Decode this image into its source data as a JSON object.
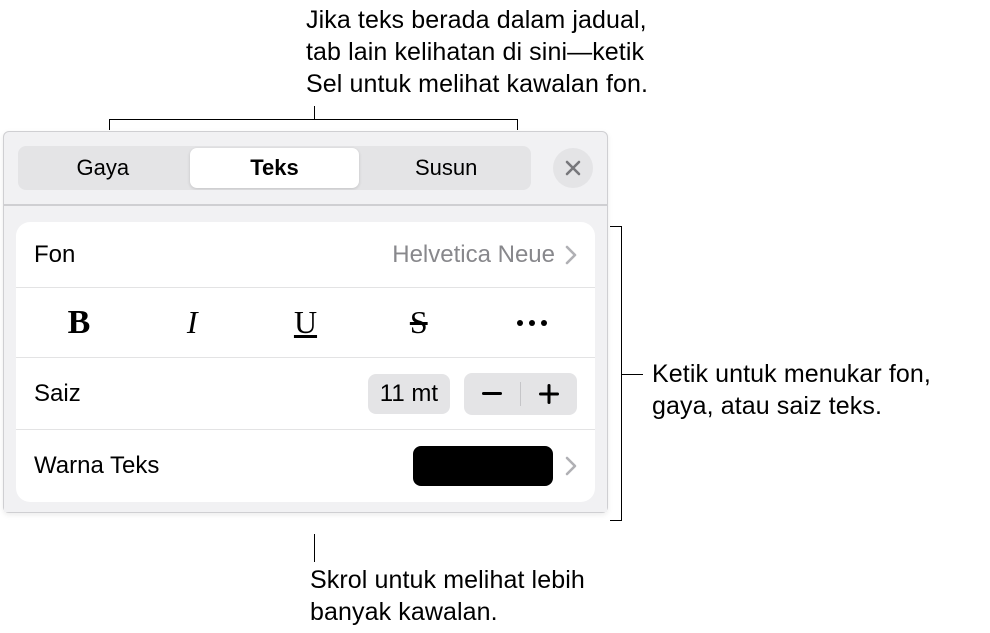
{
  "callouts": {
    "top": "Jika teks berada dalam jadual, tab lain kelihatan di sini—ketik Sel untuk melihat kawalan fon.",
    "right": "Ketik untuk menukar fon, gaya, atau saiz teks.",
    "bottom": "Skrol untuk melihat lebih banyak kawalan."
  },
  "tabs": {
    "style": "Gaya",
    "text": "Teks",
    "arrange": "Susun"
  },
  "rows": {
    "font": {
      "label": "Fon",
      "value": "Helvetica Neue"
    },
    "size": {
      "label": "Saiz",
      "value": "11 mt"
    },
    "textColor": {
      "label": "Warna Teks",
      "color": "#000000"
    }
  }
}
